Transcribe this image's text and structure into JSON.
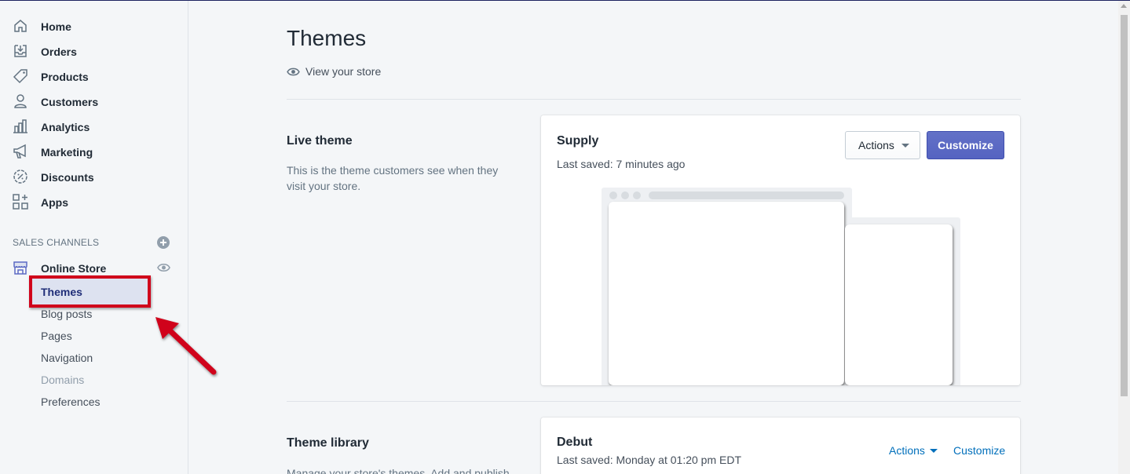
{
  "sidebar": {
    "items": [
      {
        "label": "Home",
        "icon": "home-icon"
      },
      {
        "label": "Orders",
        "icon": "orders-icon"
      },
      {
        "label": "Products",
        "icon": "tag-icon"
      },
      {
        "label": "Customers",
        "icon": "person-icon"
      },
      {
        "label": "Analytics",
        "icon": "bar-chart-icon"
      },
      {
        "label": "Marketing",
        "icon": "megaphone-icon"
      },
      {
        "label": "Discounts",
        "icon": "discount-icon"
      },
      {
        "label": "Apps",
        "icon": "apps-icon"
      }
    ],
    "sales_channels_label": "SALES CHANNELS",
    "online_store": {
      "label": "Online Store",
      "sub_items": [
        {
          "label": "Themes",
          "state": "active"
        },
        {
          "label": "Blog posts",
          "state": "normal"
        },
        {
          "label": "Pages",
          "state": "normal"
        },
        {
          "label": "Navigation",
          "state": "normal"
        },
        {
          "label": "Domains",
          "state": "disabled"
        },
        {
          "label": "Preferences",
          "state": "normal"
        }
      ]
    }
  },
  "main": {
    "title": "Themes",
    "view_store_label": "View your store",
    "live_theme": {
      "heading": "Live theme",
      "description": "This is the theme customers see when they visit your store.",
      "card": {
        "name": "Supply",
        "last_saved": "Last saved: 7 minutes ago",
        "actions_label": "Actions",
        "customize_label": "Customize"
      }
    },
    "theme_library": {
      "heading": "Theme library",
      "description": "Manage your store's themes. Add and publish",
      "card": {
        "name": "Debut",
        "last_saved": "Last saved: Monday at 01:20 pm EDT",
        "actions_label": "Actions",
        "customize_label": "Customize"
      }
    }
  },
  "colors": {
    "accent": "#5c6ac4",
    "link": "#006fbb",
    "highlight_border": "#d0021b"
  }
}
